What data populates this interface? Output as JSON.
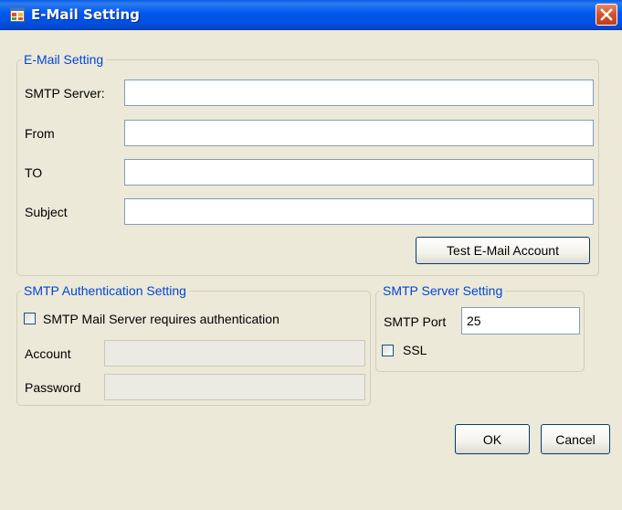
{
  "window": {
    "title": "E-Mail Setting"
  },
  "email_setting": {
    "legend": "E-Mail Setting",
    "smtp_server_label": "SMTP Server:",
    "smtp_server_value": "",
    "from_label": "From",
    "from_value": "",
    "to_label": "TO",
    "to_value": "",
    "subject_label": "Subject",
    "subject_value": "",
    "test_button": "Test E-Mail Account"
  },
  "auth_setting": {
    "legend": "SMTP Authentication Setting",
    "requires_auth_label": "SMTP Mail Server requires authentication",
    "requires_auth_checked": false,
    "account_label": "Account",
    "account_value": "",
    "password_label": "Password",
    "password_value": ""
  },
  "server_setting": {
    "legend": "SMTP Server Setting",
    "port_label": "SMTP Port",
    "port_value": "25",
    "ssl_label": "SSL",
    "ssl_checked": false
  },
  "buttons": {
    "ok": "OK",
    "cancel": "Cancel"
  },
  "colors": {
    "title_bar": "#0058ee",
    "group_legend": "#0046d5",
    "dialog_background": "#ece9d8",
    "close_button": "#d8542d"
  },
  "icons": {
    "app": "app-window-icon",
    "close": "close-icon"
  }
}
